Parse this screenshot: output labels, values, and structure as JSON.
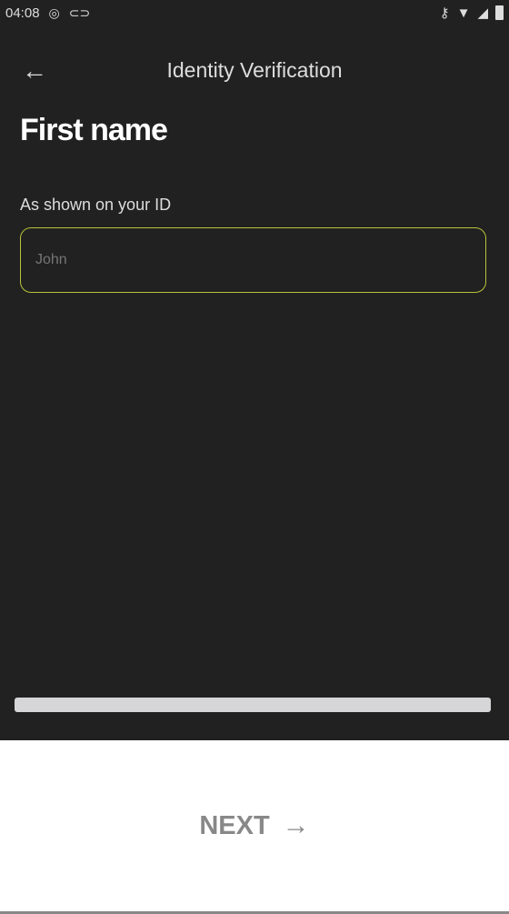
{
  "status_bar": {
    "time": "04:08",
    "left_icons": [
      "sync-icon",
      "link-icon"
    ],
    "right_icons": [
      "vpn-key-icon",
      "wifi-icon",
      "signal-icon",
      "battery-icon"
    ]
  },
  "header": {
    "title": "Identity Verification",
    "back_icon": "arrow-left-icon"
  },
  "form": {
    "heading": "First name",
    "field_label": "As shown on your ID",
    "field_placeholder": "John",
    "field_value": ""
  },
  "progress": {
    "value": 1.0
  },
  "footer": {
    "next_label": "NEXT",
    "next_icon": "arrow-right-icon"
  },
  "colors": {
    "background": "#212121",
    "input_border": "#b9c23a",
    "footer_bg": "#ffffff",
    "next_text": "#888888"
  }
}
